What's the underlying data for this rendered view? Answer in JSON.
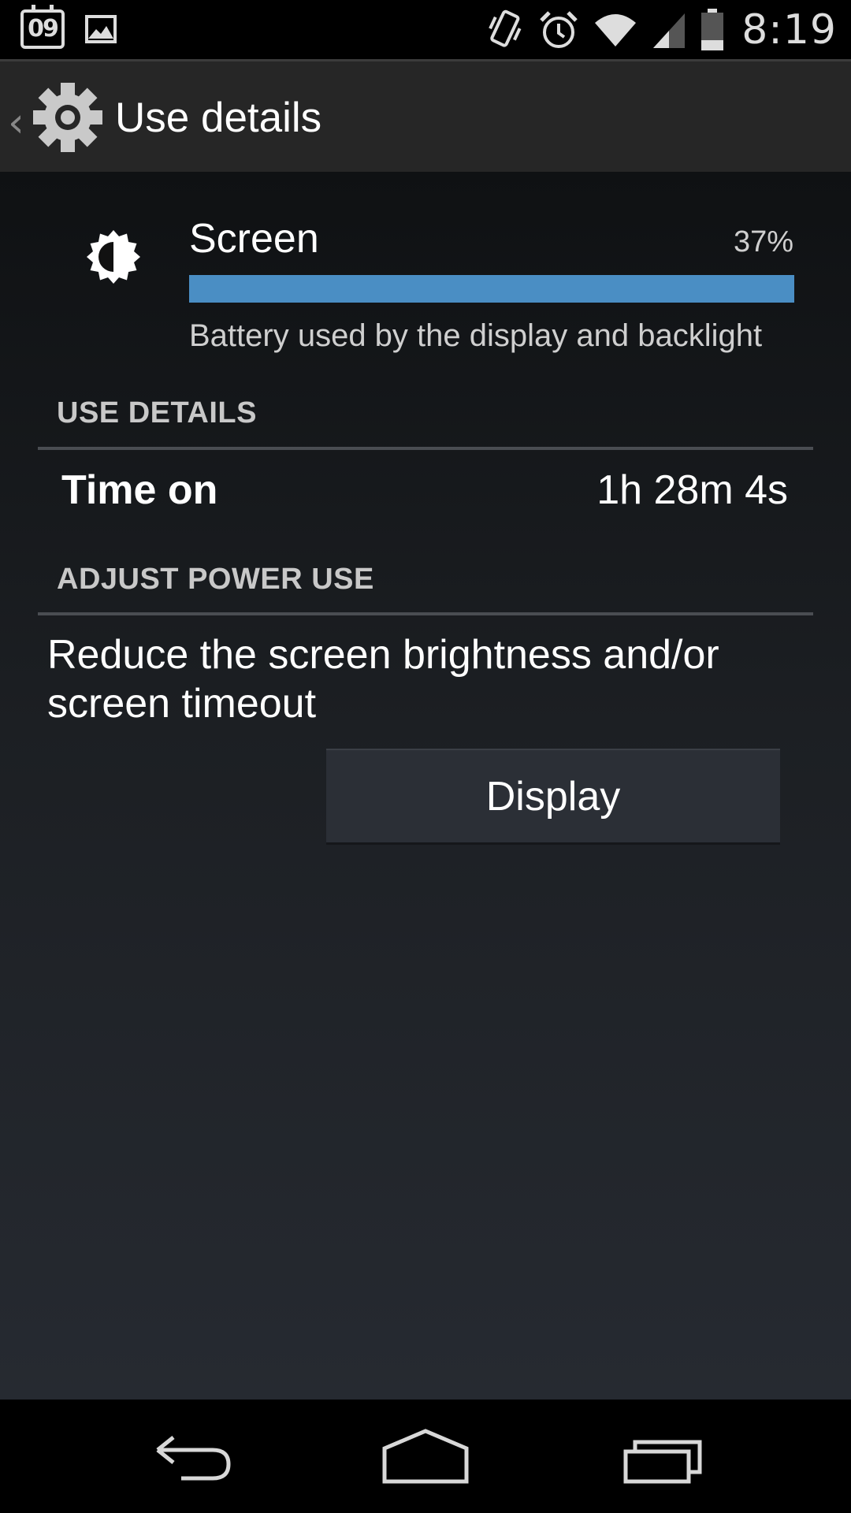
{
  "status_bar": {
    "calendar_day": "09",
    "time": "8:19",
    "left_icons": [
      "calendar-icon",
      "gallery-icon"
    ],
    "right_icons": [
      "vibrate-icon",
      "alarm-icon",
      "wifi-icon",
      "signal-icon",
      "battery-icon"
    ]
  },
  "action_bar": {
    "title": "Use details",
    "icon": "settings-gear-icon"
  },
  "usage_item": {
    "label": "Screen",
    "percent_text": "37%",
    "percent_value": 37,
    "description": "Battery used by the display and backlight",
    "icon": "brightness-icon",
    "bar_color": "#4a8ec4"
  },
  "use_details": {
    "header": "USE DETAILS",
    "time_on_label": "Time on",
    "time_on_value": "1h 28m 4s"
  },
  "adjust_power": {
    "header": "ADJUST POWER USE",
    "tip": "Reduce the screen brightness and/or screen timeout",
    "button_label": "Display"
  },
  "nav_bar": {
    "buttons": [
      "back-icon",
      "home-icon",
      "recents-icon"
    ]
  }
}
